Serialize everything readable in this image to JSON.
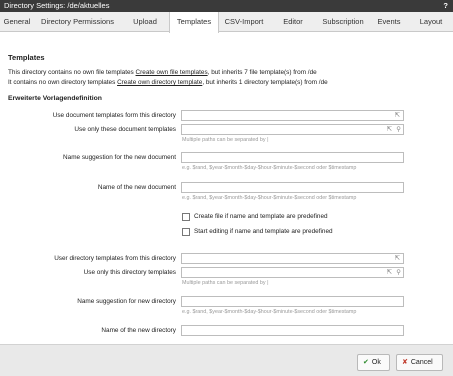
{
  "window": {
    "title": "Directory Settings: /de/aktuelles",
    "help": "?"
  },
  "tabs": [
    "General",
    "Directory Permissions",
    "Upload",
    "Templates",
    "CSV-Import",
    "Editor",
    "Subscription",
    "Events",
    "Layout"
  ],
  "active_tab": "Templates",
  "templates": {
    "heading": "Templates",
    "line1": {
      "pre": "This directory contains no own file templates ",
      "link": "Create own file templates",
      "post": ", but inherits 7 file template(s) from /de"
    },
    "line2": {
      "pre": "It contains no own directory templates ",
      "link": "Create own directory template",
      "post": ", but inherits 1 directory template(s) from /de"
    }
  },
  "extended": {
    "heading": "Erweiterte Vorlagendefinition",
    "fields": {
      "use_doc_templates_dir": {
        "label": "Use document templates form this directory",
        "value": "",
        "icon": "cursor-icon"
      },
      "use_only_doc_templates": {
        "label": "Use only these document templates",
        "value": "",
        "hint": "Multiple paths can be separated by |",
        "icons": [
          "cursor-icon",
          "search-icon"
        ]
      },
      "name_suggestion_doc": {
        "label": "Name suggestion for the new document",
        "value": "",
        "hint": "e.g. $rand, $year-$month-$day-$hour-$minute-$second oder $timestamp"
      },
      "name_new_doc": {
        "label": "Name of the new document",
        "value": "",
        "hint": "e.g. $rand, $year-$month-$day-$hour-$minute-$second oder $timestamp"
      },
      "user_dir_templates": {
        "label": "User directory templates from this directory",
        "value": "",
        "icon": "cursor-icon"
      },
      "use_only_dir_templates": {
        "label": "Use only this directory templates",
        "value": "",
        "hint": "Multiple paths can be separated by |",
        "icons": [
          "cursor-icon",
          "search-icon"
        ]
      },
      "name_suggestion_dir": {
        "label": "Name suggestion for new directory",
        "value": "",
        "hint": "e.g. $rand, $year-$month-$day-$hour-$minute-$second oder $timestamp"
      },
      "name_new_dir": {
        "label": "Name of the new directory",
        "value": ""
      }
    },
    "checkboxes": {
      "create_file": {
        "label": "Create file if name and template are predefined",
        "checked": false
      },
      "start_editing": {
        "label": "Start editing if name and template are predefined",
        "checked": false
      }
    }
  },
  "footer": {
    "ok": {
      "label": "Ok",
      "glyph": "✔",
      "color": "#2e8b2e"
    },
    "cancel": {
      "label": "Cancel",
      "glyph": "✘",
      "color": "#c0392b"
    }
  }
}
